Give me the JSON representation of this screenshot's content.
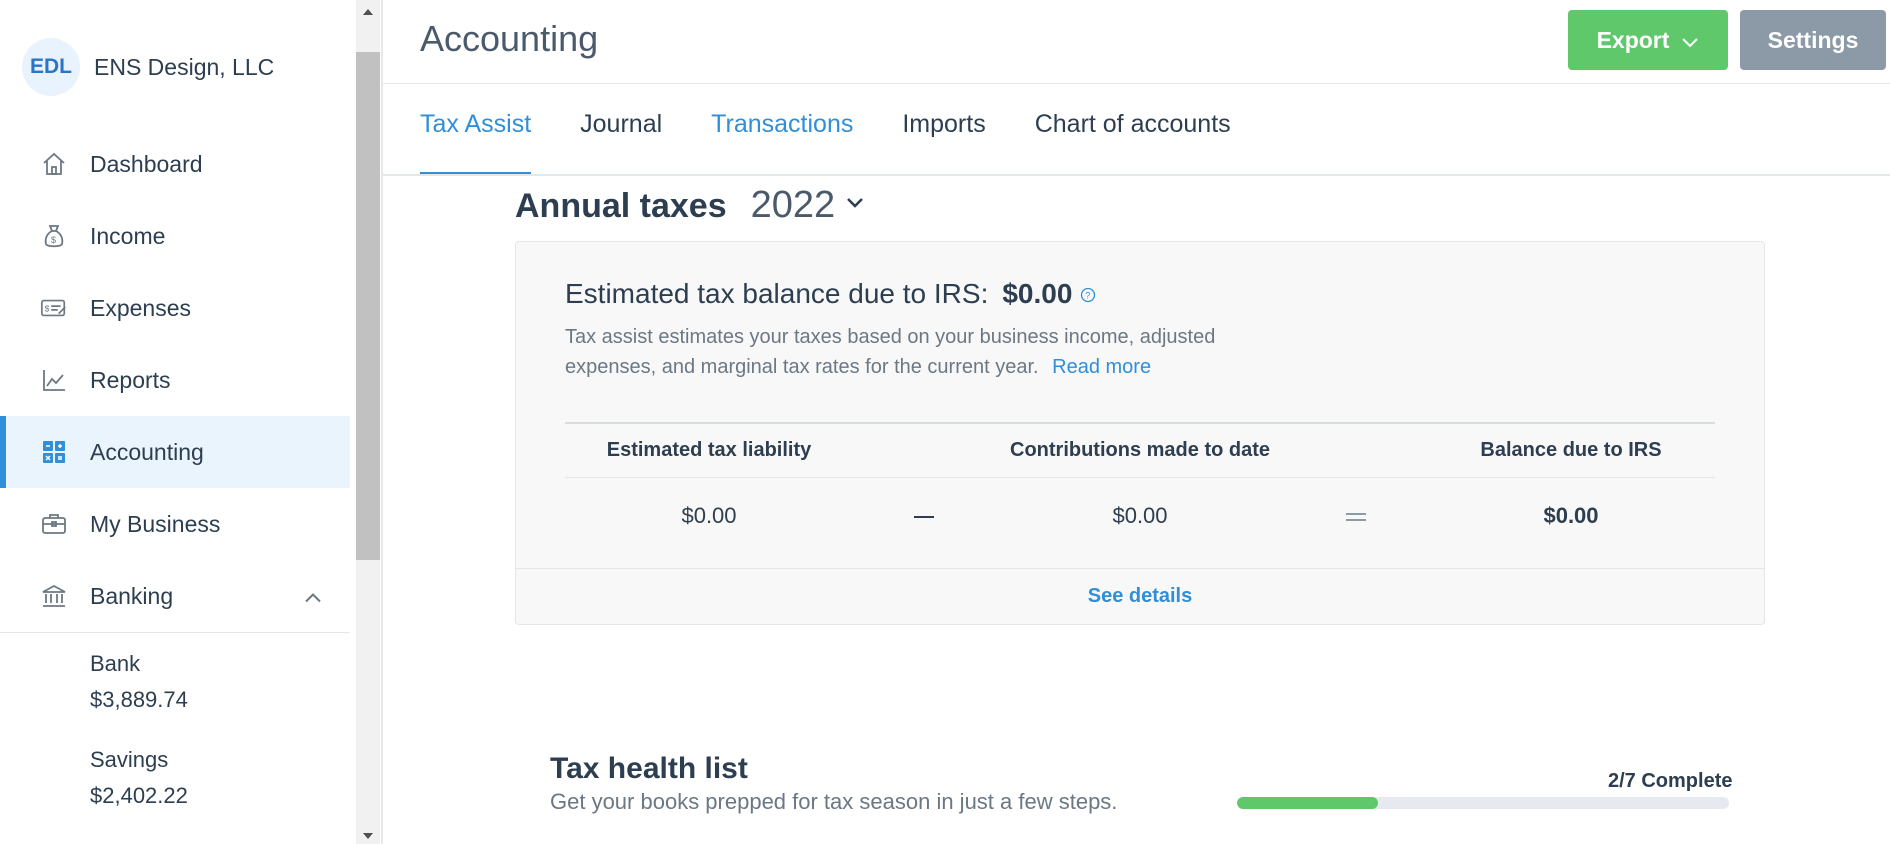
{
  "app": {
    "page_title": "Accounting"
  },
  "org": {
    "initials": "EDL",
    "name": "ENS Design, LLC"
  },
  "sidebar": {
    "items": [
      {
        "label": "Dashboard",
        "icon": "home-icon"
      },
      {
        "label": "Income",
        "icon": "money-bag-icon"
      },
      {
        "label": "Expenses",
        "icon": "receipt-icon"
      },
      {
        "label": "Reports",
        "icon": "line-chart-icon"
      },
      {
        "label": "Accounting",
        "icon": "grid-icon",
        "active": true
      },
      {
        "label": "My Business",
        "icon": "briefcase-icon"
      },
      {
        "label": "Banking",
        "icon": "bank-icon",
        "expanded": true
      }
    ],
    "banking_accounts": [
      {
        "name": "Bank",
        "balance": "$3,889.74"
      },
      {
        "name": "Savings",
        "balance": "$2,402.22"
      }
    ]
  },
  "header": {
    "export_label": "Export",
    "settings_label": "Settings"
  },
  "tabs": [
    {
      "label": "Tax Assist",
      "state": "active"
    },
    {
      "label": "Journal",
      "state": "normal"
    },
    {
      "label": "Transactions",
      "state": "link"
    },
    {
      "label": "Imports",
      "state": "normal"
    },
    {
      "label": "Chart of accounts",
      "state": "normal"
    }
  ],
  "annual": {
    "title": "Annual taxes",
    "year": "2022"
  },
  "estimate": {
    "label": "Estimated tax balance due to IRS:",
    "amount": "$0.00",
    "description": "Tax assist estimates your taxes based on your business income, adjusted expenses, and marginal tax rates for the current year.",
    "read_more": "Read more",
    "table": {
      "headers": [
        "Estimated tax liability",
        "Contributions made to date",
        "Balance due to IRS"
      ],
      "values": [
        "$0.00",
        "$0.00",
        "$0.00"
      ]
    },
    "see_details": "See details"
  },
  "tax_health": {
    "title": "Tax health list",
    "subtitle": "Get your books prepped for tax season in just a few steps.",
    "progress_label": "2/7 Complete",
    "progress_fraction": 0.2857
  },
  "colors": {
    "accent": "#2f8fd8",
    "success": "#5fc86a",
    "muted": "#8b9aa6"
  }
}
